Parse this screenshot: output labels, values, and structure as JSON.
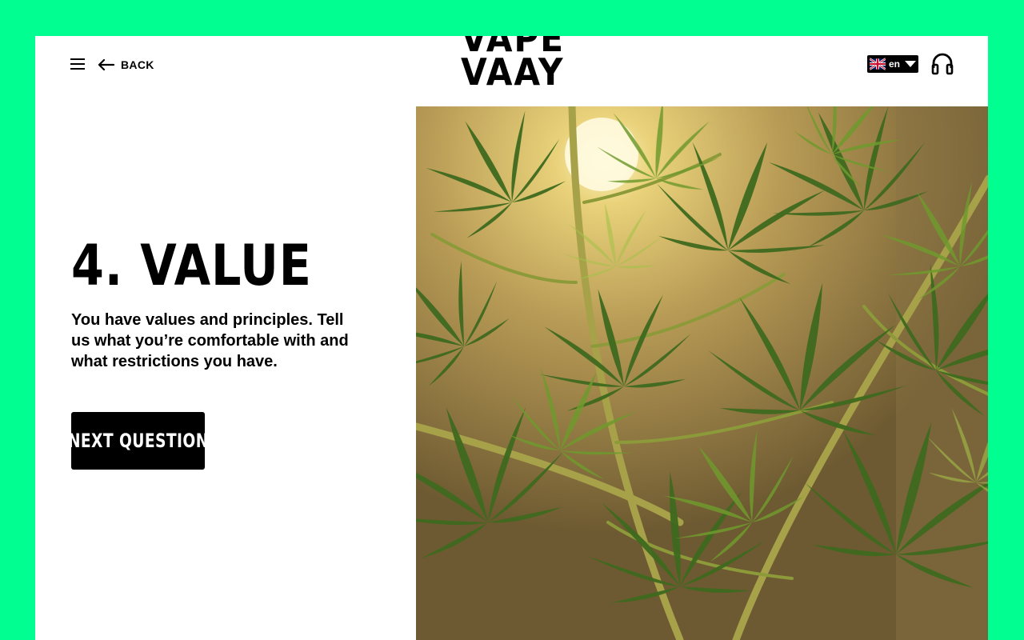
{
  "header": {
    "back_label": "BACK",
    "logo_line1": "VAPE",
    "logo_line2": "VAAY",
    "language": "en"
  },
  "question": {
    "title": "4. VALUE",
    "description": "You have values and principles. Tell us what you’re comfortable with and what restrictions you have.",
    "next_label": "NEXT QUESTION"
  },
  "icons": {
    "menu": "hamburger-menu-icon",
    "back": "arrow-left-icon",
    "flag": "uk-flag-icon",
    "dropdown": "caret-down-icon",
    "audio": "headphones-icon"
  },
  "colors": {
    "frame": "#00ff90",
    "page": "#ffffff",
    "ink": "#000000",
    "leaf": "#3f6a1f",
    "leaf_light": "#8fae3a",
    "stem": "#b5b04a",
    "light_bg": "#d9c68a"
  }
}
